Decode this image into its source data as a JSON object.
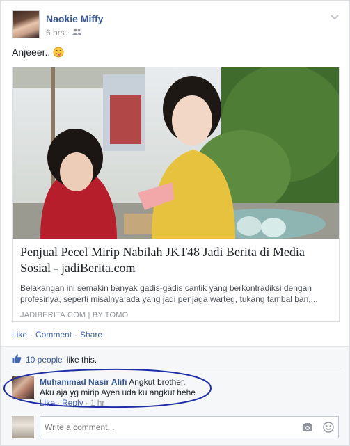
{
  "post": {
    "author": "Naokie Miffy",
    "time": "6 hrs",
    "separator": "·",
    "privacy_icon": "friends-icon",
    "text": "Anjeeer..",
    "emoji_icon": "tongue-emoji-icon"
  },
  "link": {
    "title": "Penjual Pecel Mirip Nabilah JKT48 Jadi Berita di Media Sosial - jadiBerita.com",
    "description": "Belakangan ini semakin banyak gadis-gadis cantik yang berkontradiksi dengan profesinya, seperti misalnya ada yang jadi penjaga warteg, tukang tambal ban,...",
    "source": "JADIBERITA.COM | BY TOMO"
  },
  "actions": {
    "like": "Like",
    "comment": "Comment",
    "share": "Share",
    "dot": "·"
  },
  "likes": {
    "count": "10 people",
    "suffix": "like this."
  },
  "comment": {
    "author": "Muhammad Nasir Alifi",
    "line1": "Angkut brother.",
    "line2": "Aku aja yg mirip Ayen uda ku angkut hehe",
    "like": "Like",
    "reply": "Reply",
    "time": "1 hr",
    "dot": "·"
  },
  "composer": {
    "placeholder": "Write a comment..."
  },
  "colors": {
    "link_blue": "#365899",
    "action_blue": "#4267b2",
    "annotation_blue": "#1f2fa8",
    "meta_gray": "#90949c"
  }
}
